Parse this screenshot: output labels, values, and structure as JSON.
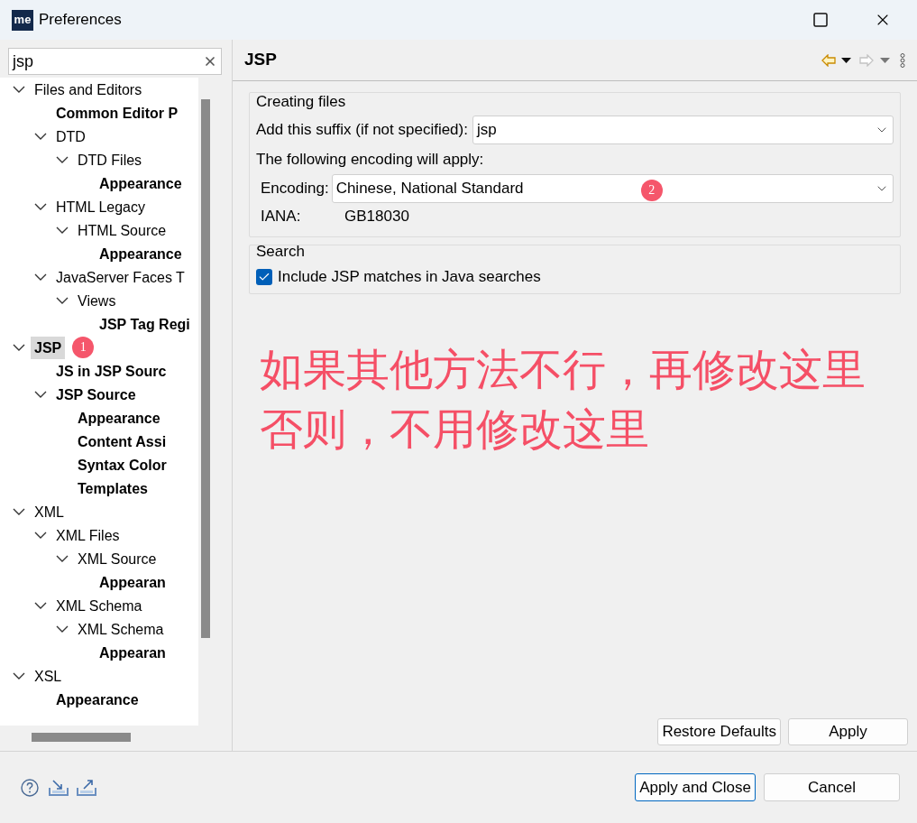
{
  "window": {
    "logo": "me",
    "title": "Preferences"
  },
  "filter": {
    "value": "jsp"
  },
  "tree": [
    {
      "label": "Files and Editors",
      "bold": false,
      "selected": false,
      "expanded": true,
      "children": [
        {
          "label": "Common Editor P",
          "bold": true,
          "selected": false
        },
        {
          "label": "DTD",
          "bold": false,
          "selected": false,
          "expanded": true,
          "children": [
            {
              "label": "DTD Files",
              "bold": false,
              "selected": false,
              "expanded": true,
              "children": [
                {
                  "label": "Appearance",
                  "bold": true,
                  "selected": false
                }
              ]
            }
          ]
        },
        {
          "label": "HTML Legacy",
          "bold": false,
          "selected": false,
          "expanded": true,
          "children": [
            {
              "label": "HTML Source",
              "bold": false,
              "selected": false,
              "expanded": true,
              "children": [
                {
                  "label": "Appearance",
                  "bold": true,
                  "selected": false
                }
              ]
            }
          ]
        },
        {
          "label": "JavaServer Faces T",
          "bold": false,
          "selected": false,
          "expanded": true,
          "children": [
            {
              "label": "Views",
              "bold": false,
              "selected": false,
              "expanded": true,
              "children": [
                {
                  "label": "JSP Tag Regi",
                  "bold": true,
                  "selected": false
                }
              ]
            }
          ]
        }
      ]
    },
    {
      "label": "JSP",
      "bold": true,
      "selected": true,
      "expanded": true,
      "badge": "1",
      "children": [
        {
          "label": "JS in JSP Sourc",
          "bold": true,
          "selected": false
        },
        {
          "label": "JSP Source",
          "bold": true,
          "selected": false,
          "expanded": true,
          "children": [
            {
              "label": "Appearance",
              "bold": true,
              "selected": false
            },
            {
              "label": "Content Assi",
              "bold": true,
              "selected": false
            },
            {
              "label": "Syntax Color",
              "bold": true,
              "selected": false
            },
            {
              "label": "Templates",
              "bold": true,
              "selected": false
            }
          ]
        }
      ]
    },
    {
      "label": "XML",
      "bold": false,
      "selected": false,
      "expanded": true,
      "children": [
        {
          "label": "XML Files",
          "bold": false,
          "selected": false,
          "expanded": true,
          "children": [
            {
              "label": "XML Source",
              "bold": false,
              "selected": false,
              "expanded": true,
              "children": [
                {
                  "label": "Appearan",
                  "bold": true,
                  "selected": false
                }
              ]
            }
          ]
        },
        {
          "label": "XML Schema",
          "bold": false,
          "selected": false,
          "expanded": true,
          "children": [
            {
              "label": "XML Schema",
              "bold": false,
              "selected": false,
              "expanded": true,
              "children": [
                {
                  "label": "Appearan",
                  "bold": true,
                  "selected": false
                }
              ]
            }
          ]
        }
      ]
    },
    {
      "label": "XSL",
      "bold": false,
      "selected": false,
      "expanded": true,
      "children": [
        {
          "label": "Appearance",
          "bold": true,
          "selected": false
        }
      ]
    }
  ],
  "page": {
    "title": "JSP",
    "creating_files": {
      "title": "Creating files",
      "suffix_label": "Add this suffix (if not specified):",
      "suffix_value": "jsp",
      "encoding_note": "The following encoding will apply:",
      "encoding_label": "Encoding:",
      "encoding_value": "Chinese, National Standard",
      "encoding_badge": "2",
      "iana_label": "IANA:",
      "iana_value": "GB18030"
    },
    "search": {
      "title": "Search",
      "option": {
        "label": "Include JSP matches in Java searches",
        "checked": true
      }
    },
    "note": [
      "如果其他方法不行，再修改这里",
      "否则，不用修改这里"
    ],
    "buttons": [
      "Restore Defaults",
      "Apply"
    ]
  },
  "footer_buttons": [
    {
      "label": "Apply and Close",
      "default": true
    },
    {
      "label": "Cancel",
      "default": false
    }
  ]
}
